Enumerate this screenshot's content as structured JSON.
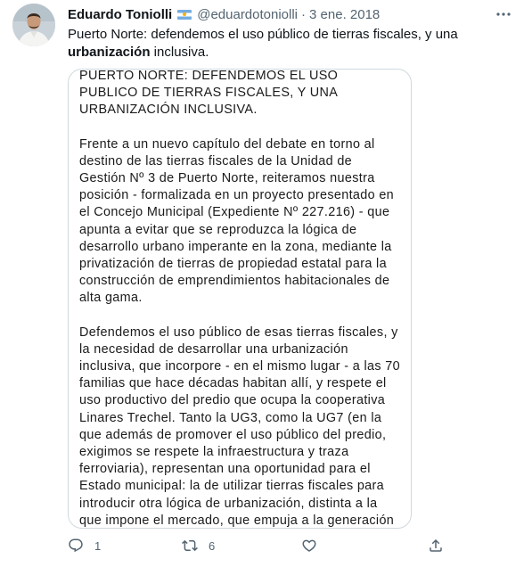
{
  "tweet": {
    "author_name": "Eduardo Toniolli",
    "handle": "@eduardotoniolli",
    "separator": "·",
    "date": "3 ene. 2018",
    "text_before": "Puerto Norte: defendemos el uso público de tierras fiscales, y una ",
    "text_bold": "urbanización",
    "text_after": " inclusiva."
  },
  "card": {
    "title": "PUERTO NORTE: DEFENDEMOS EL USO PUBLICO DE TIERRAS FISCALES, Y UNA URBANIZACIÓN INCLUSIVA.",
    "paragraph_1": "Frente a un nuevo capítulo del debate en torno al destino de las tierras fiscales de la Unidad de Gestión Nº 3 de Puerto Norte, reiteramos nuestra posición - formalizada en un proyecto presentado en el Concejo Municipal (Expediente Nº 227.216) - que apunta a evitar que se reproduzca la lógica de desarrollo urbano imperante en la zona, mediante la privatización de tierras de propiedad estatal para la construcción de emprendimientos habitacionales de alta gama.",
    "paragraph_2": "Defendemos el uso público de esas tierras fiscales, y la necesidad de desarrollar una urbanización inclusiva, que incorpore - en el mismo lugar - a las 70 familias que hace décadas habitan allí, y respete el uso productivo del predio que ocupa la cooperativa Linares Trechel. Tanto la UG3, como la UG7 (en la que además de promover el uso público del predio, exigimos se respete la infraestructura y traza ferroviaria), representan una oportunidad para el Estado municipal: la de utilizar tierras fiscales para introducir otra lógica de urbanización, distinta a la que impone el mercado, que empuja a la generación de guetos para ricos y guetos para pobres."
  },
  "actions": {
    "reply_count": "1",
    "retweet_count": "6"
  },
  "icons": {
    "avatar": "avatar-photo",
    "flag": "argentina-flag-icon",
    "more": "more-icon",
    "reply": "reply-icon",
    "retweet": "retweet-icon",
    "like": "heart-icon",
    "share": "share-icon"
  },
  "colors": {
    "text": "#0f1419",
    "secondary": "#536471",
    "border": "#cfd9de"
  }
}
